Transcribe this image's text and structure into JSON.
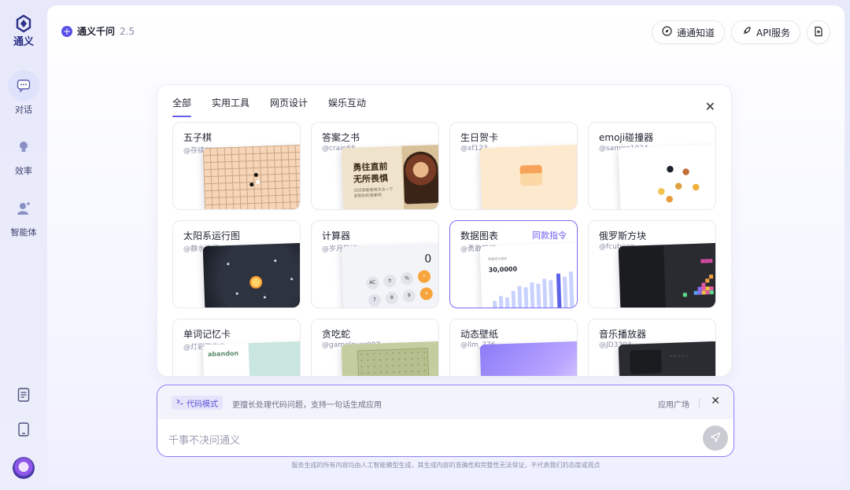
{
  "sidebar": {
    "brand": "通义",
    "items": [
      {
        "label": "对话",
        "icon": "chat-icon",
        "active": true
      },
      {
        "label": "效率",
        "icon": "lightbulb-icon",
        "active": false
      },
      {
        "label": "智能体",
        "icon": "agent-icon",
        "active": false
      }
    ],
    "bottom_icons": [
      "document-icon",
      "tablet-icon",
      "avatar"
    ]
  },
  "header": {
    "model_name": "通义千问",
    "model_version": "2.5",
    "actions": [
      {
        "label": "通通知道",
        "icon": "compass-icon"
      },
      {
        "label": "API服务",
        "icon": "rocket-icon"
      },
      {
        "label": "",
        "icon": "new-doc-icon"
      }
    ]
  },
  "modal": {
    "tabs": [
      {
        "label": "全部",
        "active": true
      },
      {
        "label": "实用工具",
        "active": false
      },
      {
        "label": "网页设计",
        "active": false
      },
      {
        "label": "娱乐互动",
        "active": false
      }
    ],
    "cards": [
      {
        "title": "五子棋",
        "author": "@存续123"
      },
      {
        "title": "答案之书",
        "author": "@crain66",
        "thumb_title": "勇往直前\n无所畏惧",
        "thumb_sub": "试试答案使用方法一下\n获取你的答案吧"
      },
      {
        "title": "生日贺卡",
        "author": "@xf123"
      },
      {
        "title": "emoji碰撞器",
        "author": "@samira1024"
      },
      {
        "title": "太阳系运行图",
        "author": "@静水流深"
      },
      {
        "title": "计算器",
        "author": "@岁月静好",
        "thumb_display": "0",
        "keys": [
          "AC",
          "±",
          "%",
          "÷",
          "7",
          "8",
          "9",
          "×"
        ]
      },
      {
        "title": "数据图表",
        "author": "@勇敢前行",
        "extra": "同款指令",
        "thumb_value": "30,0000",
        "thumb_label": "数据统计图表"
      },
      {
        "title": "俄罗斯方块",
        "author": "@fcubeee"
      },
      {
        "title": "单词记忆卡",
        "author": "@灯彩路秦穹",
        "thumb_word": "abandon"
      },
      {
        "title": "贪吃蛇",
        "author": "@gamelover007"
      },
      {
        "title": "动态壁纸",
        "author": "@llm_776"
      },
      {
        "title": "音乐播放器",
        "author": "@JD3303"
      }
    ]
  },
  "composer": {
    "mode_chip": "代码模式",
    "mode_desc": "更擅长处理代码问题，支持一句话生成应用",
    "plaza_label": "应用广场",
    "placeholder": "千事不决问通义"
  },
  "disclaimer": "服务生成的所有内容均由人工智能模型生成，其生成内容的准确性和完整性无法保证，不代表我们的态度或观点",
  "colors": {
    "accent": "#6a5cf0",
    "brand": "#2b2f86"
  }
}
